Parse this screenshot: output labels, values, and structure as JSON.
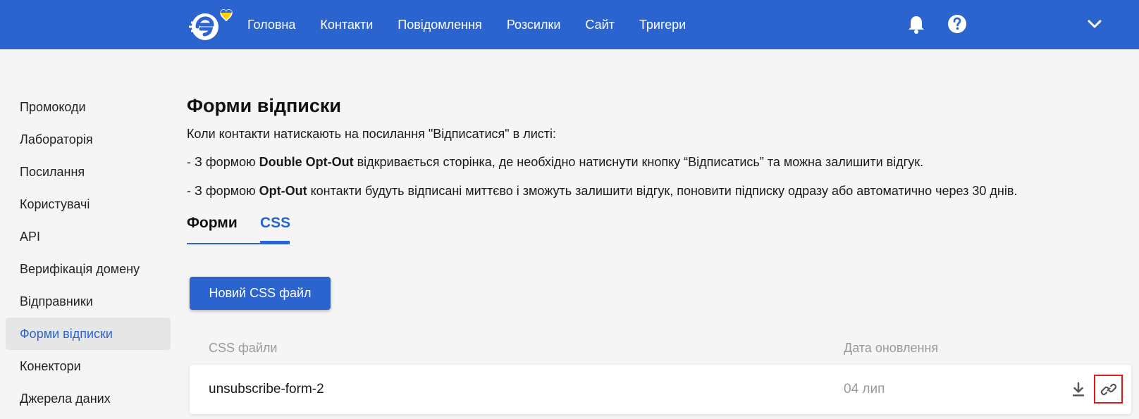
{
  "header": {
    "nav": [
      "Головна",
      "Контакти",
      "Повідомлення",
      "Розсилки",
      "Сайт",
      "Тригери"
    ],
    "icons": [
      "logo-icon",
      "bell-icon",
      "help-icon",
      "chevron-down-icon"
    ]
  },
  "sidebar": {
    "items": [
      {
        "label": "Промокоди"
      },
      {
        "label": "Лабораторія"
      },
      {
        "label": "Посилання"
      },
      {
        "label": "Користувачі"
      },
      {
        "label": "API"
      },
      {
        "label": "Верифікація домену"
      },
      {
        "label": "Відправники"
      },
      {
        "label": "Форми відписки",
        "active": true
      },
      {
        "label": "Конектори"
      },
      {
        "label": "Джерела даних"
      }
    ]
  },
  "main": {
    "title": "Форми відписки",
    "intro": "Коли контакти натискають на посилання \"Відписатися\" в листі:",
    "line2_prefix": "- З формою ",
    "line2_bold": "Double Opt-Out",
    "line2_rest": " відкривається сторінка, де необхідно натиснути кнопку “Відписатись” та можна залишити відгук.",
    "line3_prefix": "- З формою ",
    "line3_bold": "Opt-Out",
    "line3_rest": " контакти будуть відписані миттєво і зможуть залишити відгук, поновити підписку одразу або автоматично через 30 днів.",
    "tabs": [
      {
        "label": "Форми",
        "active": false
      },
      {
        "label": "CSS",
        "active": true
      }
    ],
    "new_button": "Новий CSS файл",
    "table": {
      "headers": [
        "CSS файли",
        "Дата оновлення"
      ],
      "rows": [
        {
          "name": "unsubscribe-form-2",
          "date": "04 лип"
        }
      ]
    }
  },
  "colors": {
    "primary": "#2b63cf",
    "highlight_border": "#e0191b",
    "muted_text": "#9a9a9a",
    "logo_heart_blue": "#2b6ad3",
    "logo_heart_yellow": "#ffd400"
  }
}
